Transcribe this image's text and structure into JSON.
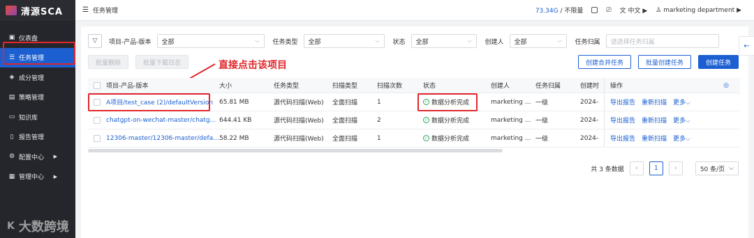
{
  "app": {
    "logo_text": "清源SCA"
  },
  "sidebar": {
    "items": [
      {
        "label": "仪表盘",
        "icon": "dashboard-icon"
      },
      {
        "label": "任务管理",
        "icon": "list-icon",
        "active": true
      },
      {
        "label": "成分管理",
        "icon": "component-icon"
      },
      {
        "label": "策略管理",
        "icon": "policy-icon"
      },
      {
        "label": "知识库",
        "icon": "book-icon"
      },
      {
        "label": "报告管理",
        "icon": "report-icon"
      },
      {
        "label": "配置中心",
        "icon": "gear-icon",
        "has_children": true
      },
      {
        "label": "管理中心",
        "icon": "admin-icon",
        "has_children": true
      }
    ],
    "watermark": "大数跨境"
  },
  "topbar": {
    "title": "任务管理",
    "quota_used": "73.34G",
    "quota_sep": "/",
    "quota_total": "不限量",
    "language": "中文",
    "user": "marketing department"
  },
  "filters": {
    "project_label": "项目-产品-版本",
    "project_value": "全部",
    "task_type_label": "任务类型",
    "task_type_value": "全部",
    "status_label": "状态",
    "status_value": "全部",
    "creator_label": "创建人",
    "creator_value": "全部",
    "owner_label": "任务归属",
    "owner_placeholder": "请选择任务归属"
  },
  "actions": {
    "batch_delete": "批量删除",
    "batch_download_log": "批量下载日志",
    "create_merge": "创建合并任务",
    "batch_create": "批量创建任务",
    "create_task": "创建任务"
  },
  "annotation": "直接点击该项目",
  "table": {
    "headers": {
      "name": "项目-产品-版本",
      "size": "大小",
      "task_type": "任务类型",
      "scan_type": "扫描类型",
      "scan_count": "扫描次数",
      "status": "状态",
      "creator": "创建人",
      "owner": "任务归属",
      "created": "创建时",
      "ops": "操作"
    },
    "rows": [
      {
        "name": "A项目/test_case (2)/defaultVersion",
        "size": "65.81 MB",
        "task_type": "源代码扫描(Web)",
        "scan_type": "全面扫描",
        "scan_count": "1",
        "status": "数据分析完成",
        "creator": "marketing ...",
        "owner": "一级",
        "created": "2024-",
        "op_export": "导出报告",
        "op_rescan": "重新扫描",
        "op_more": "更多"
      },
      {
        "name": "chatgpt-on-wechat-master/chatg...",
        "size": "644.41 KB",
        "task_type": "源代码扫描(Web)",
        "scan_type": "全面扫描",
        "scan_count": "2",
        "status": "数据分析完成",
        "creator": "marketing ...",
        "owner": "一级",
        "created": "2024-",
        "op_export": "导出报告",
        "op_rescan": "重新扫描",
        "op_more": "更多"
      },
      {
        "name": "12306-master/12306-master/defa...",
        "size": "58.22 MB",
        "task_type": "源代码扫描(Web)",
        "scan_type": "全面扫描",
        "scan_count": "1",
        "status": "数据分析完成",
        "creator": "marketing ...",
        "owner": "一级",
        "created": "2024-",
        "op_export": "导出报告",
        "op_rescan": "重新扫描",
        "op_more": "更多"
      }
    ]
  },
  "pagination": {
    "total_text": "共 3 条数据",
    "current_page": "1",
    "page_size": "50 条/页"
  },
  "colors": {
    "primary": "#1b5fd1",
    "highlight": "#e0262b",
    "success": "#2aa55d"
  }
}
